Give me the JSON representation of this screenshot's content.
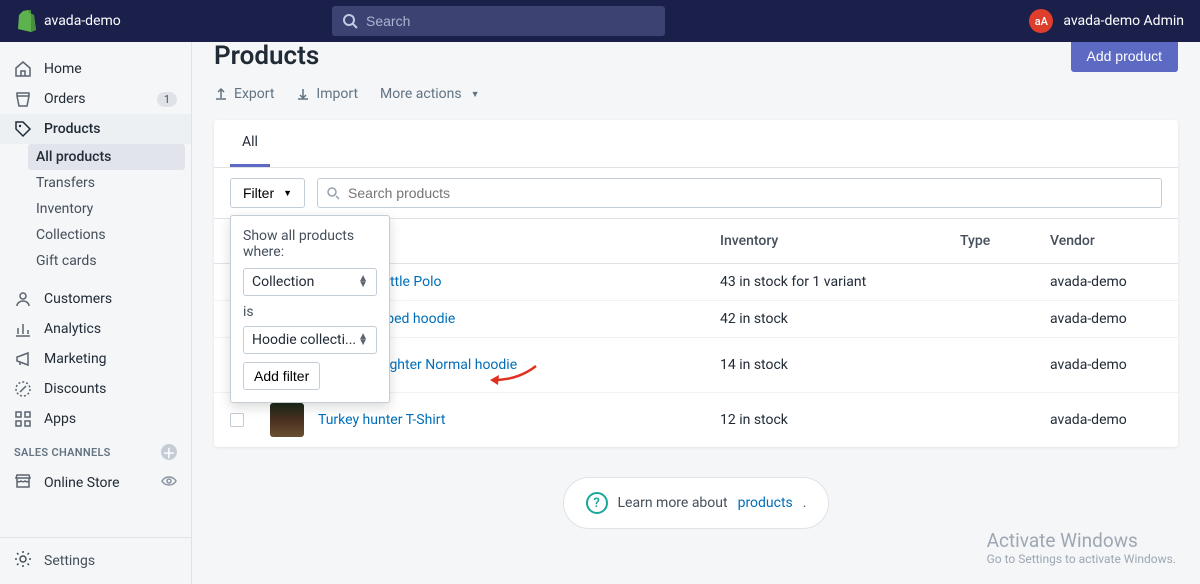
{
  "app": {
    "store_name": "avada-demo",
    "search_placeholder": "Search",
    "user_initials": "aA",
    "user_name": "avada-demo Admin"
  },
  "sidebar": {
    "items": [
      {
        "label": "Home"
      },
      {
        "label": "Orders",
        "badge": "1"
      },
      {
        "label": "Products"
      },
      {
        "label": "Customers"
      },
      {
        "label": "Analytics"
      },
      {
        "label": "Marketing"
      },
      {
        "label": "Discounts"
      },
      {
        "label": "Apps"
      }
    ],
    "products_sub": [
      {
        "label": "All products",
        "active": true
      },
      {
        "label": "Transfers"
      },
      {
        "label": "Inventory"
      },
      {
        "label": "Collections"
      },
      {
        "label": "Gift cards"
      }
    ],
    "channels_header": "SALES CHANNELS",
    "channels": [
      {
        "label": "Online Store"
      }
    ],
    "settings": "Settings"
  },
  "page": {
    "title": "Products",
    "add_button": "Add product",
    "toolbar": {
      "export": "Export",
      "import": "Import",
      "more": "More actions"
    },
    "tab_all": "All",
    "filter_label": "Filter",
    "search_placeholder": "Search products"
  },
  "popover": {
    "title": "Show all products where:",
    "field_selected": "Collection",
    "is": "is",
    "value_selected": "Hoodie collecti...",
    "add_filter": "Add filter"
  },
  "table": {
    "headers": {
      "inventory": "Inventory",
      "type": "Type",
      "vendor": "Vendor"
    },
    "rows": [
      {
        "name": "cattle Polo",
        "inventory": "43 in stock for 1 variant",
        "type": "",
        "vendor": "avada-demo"
      },
      {
        "name": "ipped hoodie",
        "inventory": "42 in stock",
        "type": "",
        "vendor": "avada-demo"
      },
      {
        "name": "Proud Firefighter Normal hoodie",
        "inventory": "14 in stock",
        "type": "",
        "vendor": "avada-demo"
      },
      {
        "name": "Turkey hunter T-Shirt",
        "inventory": "12 in stock",
        "type": "",
        "vendor": "avada-demo"
      }
    ]
  },
  "learn": {
    "text": "Learn more about ",
    "link": "products"
  },
  "watermark": {
    "line1": "Activate Windows",
    "line2": "Go to Settings to activate Windows."
  }
}
